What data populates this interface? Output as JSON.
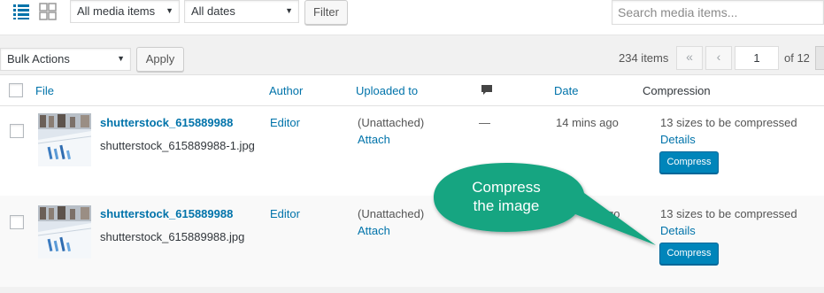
{
  "toolbar": {
    "media_filter": "All media items",
    "date_filter": "All dates",
    "filter_button": "Filter",
    "search_placeholder": "Search media items..."
  },
  "tablenav": {
    "bulk_actions": "Bulk Actions",
    "apply_button": "Apply",
    "items_count": "234 items",
    "first_page": "«",
    "prev_page": "‹",
    "current_page": "1",
    "of_pages": "of 12"
  },
  "table": {
    "headers": {
      "file": "File",
      "author": "Author",
      "uploaded_to": "Uploaded to",
      "comments_icon": "comment-icon",
      "date": "Date",
      "compression": "Compression"
    },
    "rows": [
      {
        "title": "shutterstock_615889988",
        "filename": "shutterstock_615889988-1.jpg",
        "author": "Editor",
        "uploaded_to": "(Unattached)",
        "attach": "Attach",
        "comments": "—",
        "date": "14 mins ago",
        "compression_status": "13 sizes to be compressed",
        "details": "Details",
        "compress_button": "Compress"
      },
      {
        "title": "shutterstock_615889988",
        "filename": "shutterstock_615889988.jpg",
        "author": "Editor",
        "uploaded_to": "(Unattached)",
        "attach": "Attach",
        "date_partial": "go",
        "compression_status": "13 sizes to be compressed",
        "details": "Details",
        "compress_button": "Compress"
      }
    ]
  },
  "callout": {
    "line1": "Compress",
    "line2": "the image",
    "color": "#15a581"
  },
  "colors": {
    "link": "#0073aa",
    "primary_button": "#0085ba",
    "active_view_icon": "#0073aa"
  }
}
